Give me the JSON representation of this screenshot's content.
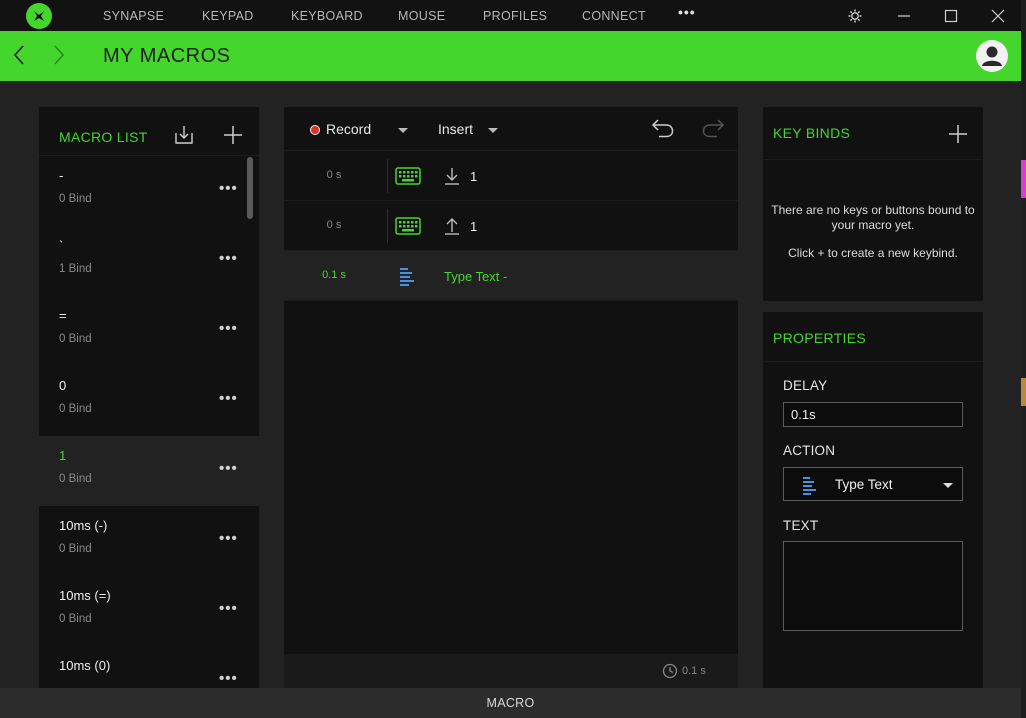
{
  "nav": {
    "items": [
      "SYNAPSE",
      "KEYPAD",
      "KEYBOARD",
      "MOUSE",
      "PROFILES",
      "CONNECT"
    ],
    "more": "•••"
  },
  "header": {
    "title": "MY MACROS"
  },
  "macro_list": {
    "heading": "MACRO LIST",
    "items": [
      {
        "name": "-",
        "binds": "0 Bind"
      },
      {
        "name": "`",
        "binds": "1 Bind"
      },
      {
        "name": "=",
        "binds": "0 Bind"
      },
      {
        "name": "0",
        "binds": "0 Bind"
      },
      {
        "name": "1",
        "binds": "0 Bind"
      },
      {
        "name": "10ms (-)",
        "binds": "0 Bind"
      },
      {
        "name": "10ms (=)",
        "binds": "0 Bind"
      },
      {
        "name": "10ms (0)",
        "binds": ""
      }
    ],
    "selected_index": 4,
    "more": "•••"
  },
  "editor": {
    "record_label": "Record",
    "insert_label": "Insert",
    "steps": [
      {
        "delay": "0 s",
        "icon": "keyboard-icon",
        "direction": "down",
        "text": "1"
      },
      {
        "delay": "0 s",
        "icon": "keyboard-icon",
        "direction": "up",
        "text": "1"
      },
      {
        "delay": "0.1 s",
        "icon": "type-text-icon",
        "direction": "",
        "text": "Type Text -"
      }
    ],
    "selected_step": 2,
    "total_time": "0.1 s"
  },
  "key_binds": {
    "heading": "KEY BINDS",
    "empty_line1": "There are no keys or buttons bound to your macro yet.",
    "empty_line2": "Click + to create a new keybind."
  },
  "properties": {
    "heading": "PROPERTIES",
    "delay_label": "DELAY",
    "delay_value": "0.1s",
    "action_label": "ACTION",
    "action_value": "Type Text",
    "text_label": "TEXT",
    "text_value": ""
  },
  "footer": {
    "label": "MACRO"
  },
  "colors": {
    "accent": "#44d62c",
    "record": "#e03030",
    "type_text_icon": "#4a90e2"
  }
}
